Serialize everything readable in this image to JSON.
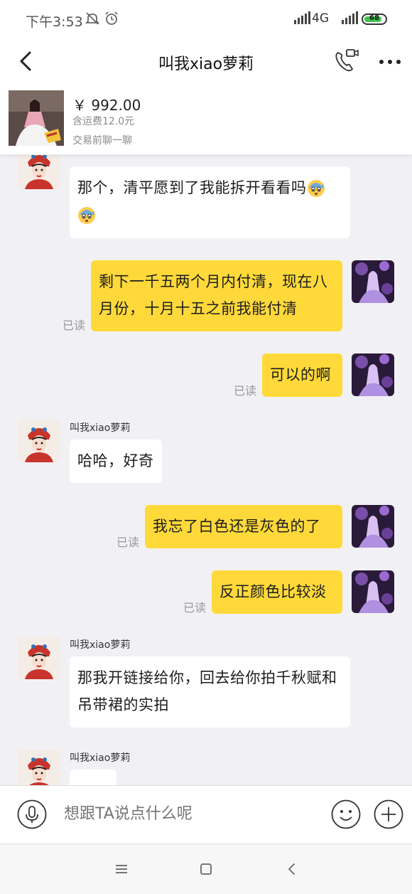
{
  "status_bar": {
    "time": "下午3:53",
    "network": "4G",
    "battery": "68",
    "icons": [
      "mute-bell-icon",
      "alarm-icon",
      "signal-icon",
      "battery-icon"
    ]
  },
  "header": {
    "title": "叫我xiao萝莉",
    "icons": [
      "back-arrow-icon",
      "video-call-icon",
      "more-icon"
    ]
  },
  "product": {
    "price": "￥ 992.00",
    "shipping": "含运费12.0元",
    "hint": "交易前聊一聊"
  },
  "contact_name": "叫我xiao萝莉",
  "messages": [
    {
      "from": "them",
      "text": "那个，清平愿到了我能拆开看看吗"
    },
    {
      "from": "me",
      "text": "剩下一千五两个月内付清，现在八月份，十月十五之前我能付清",
      "read": "已读"
    },
    {
      "from": "me",
      "text": "可以的啊",
      "read": "已读"
    },
    {
      "from": "them",
      "name": "叫我xiao萝莉",
      "text": "哈哈，好奇"
    },
    {
      "from": "me",
      "text": "我忘了白色还是灰色的了",
      "read": "已读"
    },
    {
      "from": "me",
      "text": "反正颜色比较淡",
      "read": "已读"
    },
    {
      "from": "them",
      "name": "叫我xiao萝莉",
      "text": "那我开链接给你，回去给你拍千秋赋和吊带裙的实拍"
    },
    {
      "from": "them",
      "name": "叫我xiao萝莉",
      "text": ""
    }
  ],
  "input": {
    "placeholder": "想跟TA说点什么呢",
    "icons": [
      "microphone-icon",
      "emoji-icon",
      "plus-icon"
    ]
  },
  "system_nav": [
    "menu-icon",
    "home-icon",
    "back-icon"
  ],
  "colors": {
    "outgoing_bubble": "#ffd93a",
    "incoming_bubble": "#ffffff",
    "background": "#f1f1f5"
  }
}
